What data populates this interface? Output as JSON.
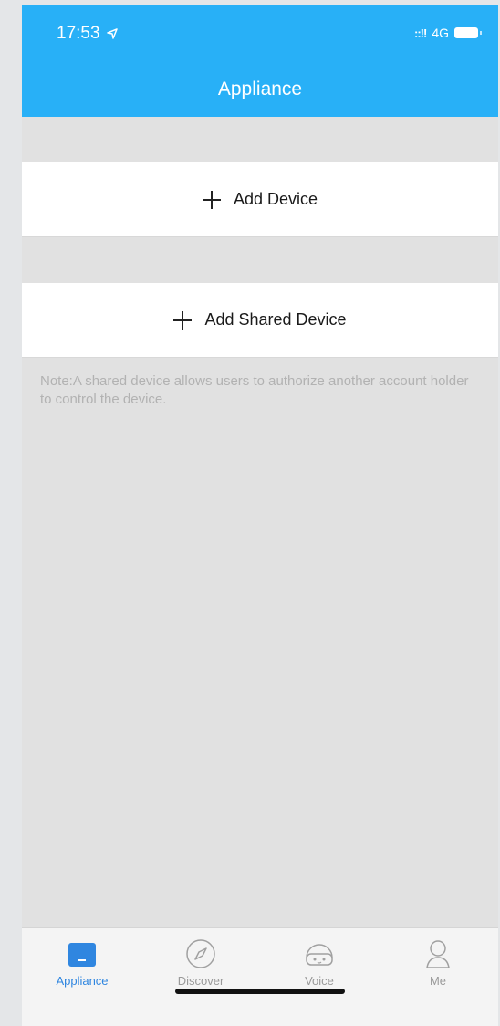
{
  "status": {
    "time": "17:53",
    "signal": "::!!",
    "network": "4G"
  },
  "header": {
    "title": "Appliance"
  },
  "actions": {
    "add_device": "Add Device",
    "add_shared_device": "Add Shared Device"
  },
  "note": "Note:A shared device allows users to authorize another account holder to control the device.",
  "tabs": [
    {
      "label": "Appliance",
      "icon": "appliance-icon",
      "active": true
    },
    {
      "label": "Discover",
      "icon": "compass-icon",
      "active": false
    },
    {
      "label": "Voice",
      "icon": "voice-icon",
      "active": false
    },
    {
      "label": "Me",
      "icon": "person-icon",
      "active": false
    }
  ],
  "colors": {
    "header": "#28b0f7",
    "accent": "#2f86e0"
  }
}
